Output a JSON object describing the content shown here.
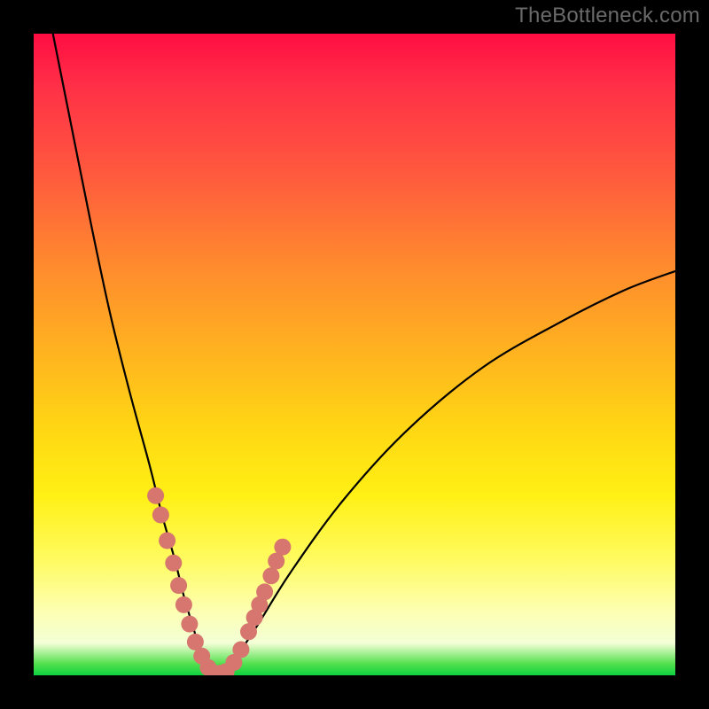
{
  "watermark": "TheBottleneck.com",
  "chart_data": {
    "type": "line",
    "title": "",
    "xlabel": "",
    "ylabel": "",
    "xlim": [
      0,
      100
    ],
    "ylim": [
      0,
      100
    ],
    "grid": false,
    "legend": false,
    "colors": {
      "curve": "#000000",
      "dots": "#d6766f",
      "gradient_top": "#ff0d42",
      "gradient_mid": "#ffd813",
      "gradient_bottom": "#0ed13f"
    },
    "series": [
      {
        "name": "bottleneck-curve",
        "x": [
          3,
          6,
          9,
          12,
          15,
          18,
          20,
          22,
          23.5,
          25,
          26,
          27,
          28,
          29,
          30,
          32,
          35,
          40,
          48,
          58,
          70,
          82,
          92,
          100
        ],
        "y": [
          100,
          85,
          70,
          56,
          44,
          33,
          25,
          18,
          12,
          7,
          3.5,
          1.2,
          0.3,
          0.3,
          1.0,
          3.5,
          8,
          16,
          27,
          38,
          48,
          55,
          60,
          63
        ]
      }
    ],
    "markers": {
      "name": "highlighted-points",
      "x": [
        19.0,
        19.8,
        20.8,
        21.8,
        22.6,
        23.4,
        24.3,
        25.2,
        26.2,
        27.2,
        28.0,
        29.0,
        30.0,
        31.2,
        32.3,
        33.5,
        34.4,
        35.2,
        36.0,
        37.0,
        37.8,
        38.8
      ],
      "y": [
        28.0,
        25.0,
        21.0,
        17.5,
        14.0,
        11.0,
        8.0,
        5.2,
        3.0,
        1.2,
        0.4,
        0.3,
        0.6,
        2.0,
        4.0,
        6.8,
        9.0,
        11.0,
        13.0,
        15.5,
        17.8,
        20.0
      ]
    }
  }
}
